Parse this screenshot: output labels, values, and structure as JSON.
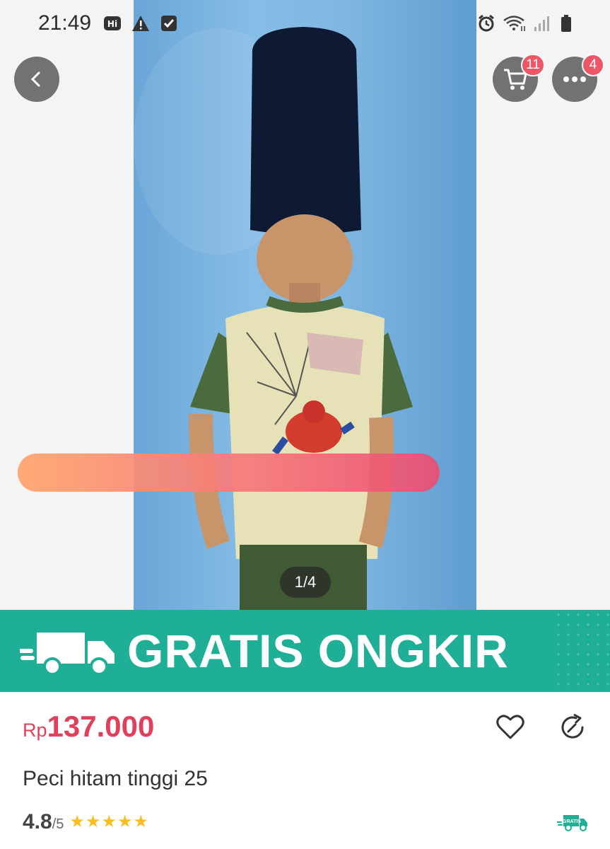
{
  "status_bar": {
    "time": "21:49",
    "icons": [
      "hi-icon",
      "warning-icon",
      "check-icon",
      "alarm-icon",
      "wifi-icon",
      "signal-icon",
      "battery-icon"
    ]
  },
  "top_bar": {
    "back_icon": "back-chevron-icon",
    "cart_badge": "11",
    "more_badge": "4"
  },
  "gallery": {
    "counter": "1/4"
  },
  "promo_banner": {
    "text": "GRATIS ONGKIR",
    "color": "#1fae96"
  },
  "product": {
    "currency": "Rp",
    "price": "137.000",
    "price_color": "#e0405c",
    "name": "Peci hitam tinggi 25",
    "rating": "4.8",
    "rating_scale": "/5",
    "stars": "★★★★★",
    "star_value": 4.8,
    "shipping_badge": "GRATIS"
  }
}
